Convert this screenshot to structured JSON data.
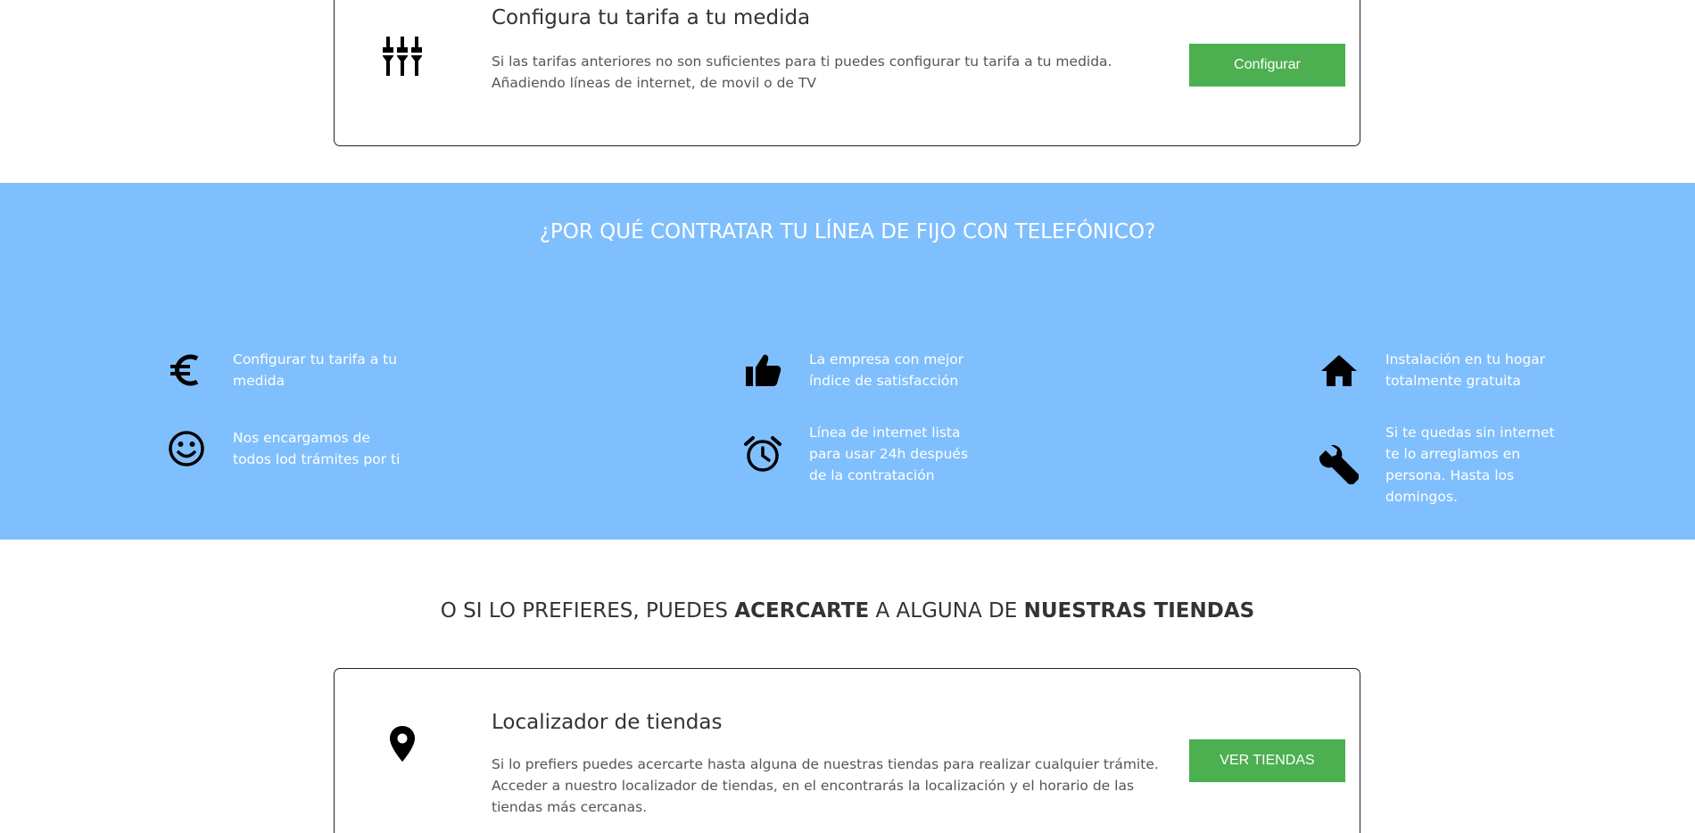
{
  "config_card": {
    "title": "Configura tu tarifa a tu medida",
    "description": "Si las tarifas anteriores no son suficientes para ti puedes configurar tu tarifa a tu medida. Añadiendo líneas de internet, de movil o de TV",
    "button_label": "Configurar",
    "icon": "settings-sliders-icon"
  },
  "why": {
    "title": "¿POR QUÉ CONTRATAR TU LÍNEA DE FIJO CON TELEFÓNICO?",
    "background": "#80bffd",
    "features": [
      {
        "icon": "euro-icon",
        "text": "Configurar tu tarifa a tu medida"
      },
      {
        "icon": "thumbs-up-icon",
        "text": "La empresa con mejor índice de satisfacción"
      },
      {
        "icon": "home-icon",
        "text": "Instalación en tu hogar totalmente gratuita"
      },
      {
        "icon": "smiley-icon",
        "text": "Nos encargamos de todos lod trámites por ti"
      },
      {
        "icon": "alarm-clock-icon",
        "text": "Línea de internet lista para usar 24h después de la contratación"
      },
      {
        "icon": "wrench-icon",
        "text": "Si te quedas sin internet te lo arreglamos en persona. Hasta los domingos."
      }
    ]
  },
  "stores_heading": {
    "part1": "O SI LO PREFIERES, PUEDES ",
    "bold1": "ACERCARTE",
    "part2": " A ALGUNA DE ",
    "bold2": "NUESTRAS TIENDAS"
  },
  "store_card": {
    "title": "Localizador de tiendas",
    "description": "Si lo prefiers puedes acercarte hasta alguna de nuestras tiendas para realizar cualquier trámite. Acceder a nuestro localizador de tiendas, en el encontrarás la localización y el horario de las tiendas más cercanas.",
    "button_label": "VER TIENDAS",
    "icon": "map-pin-icon"
  },
  "colors": {
    "button": "#4caf50",
    "blue_band": "#80bffd"
  }
}
